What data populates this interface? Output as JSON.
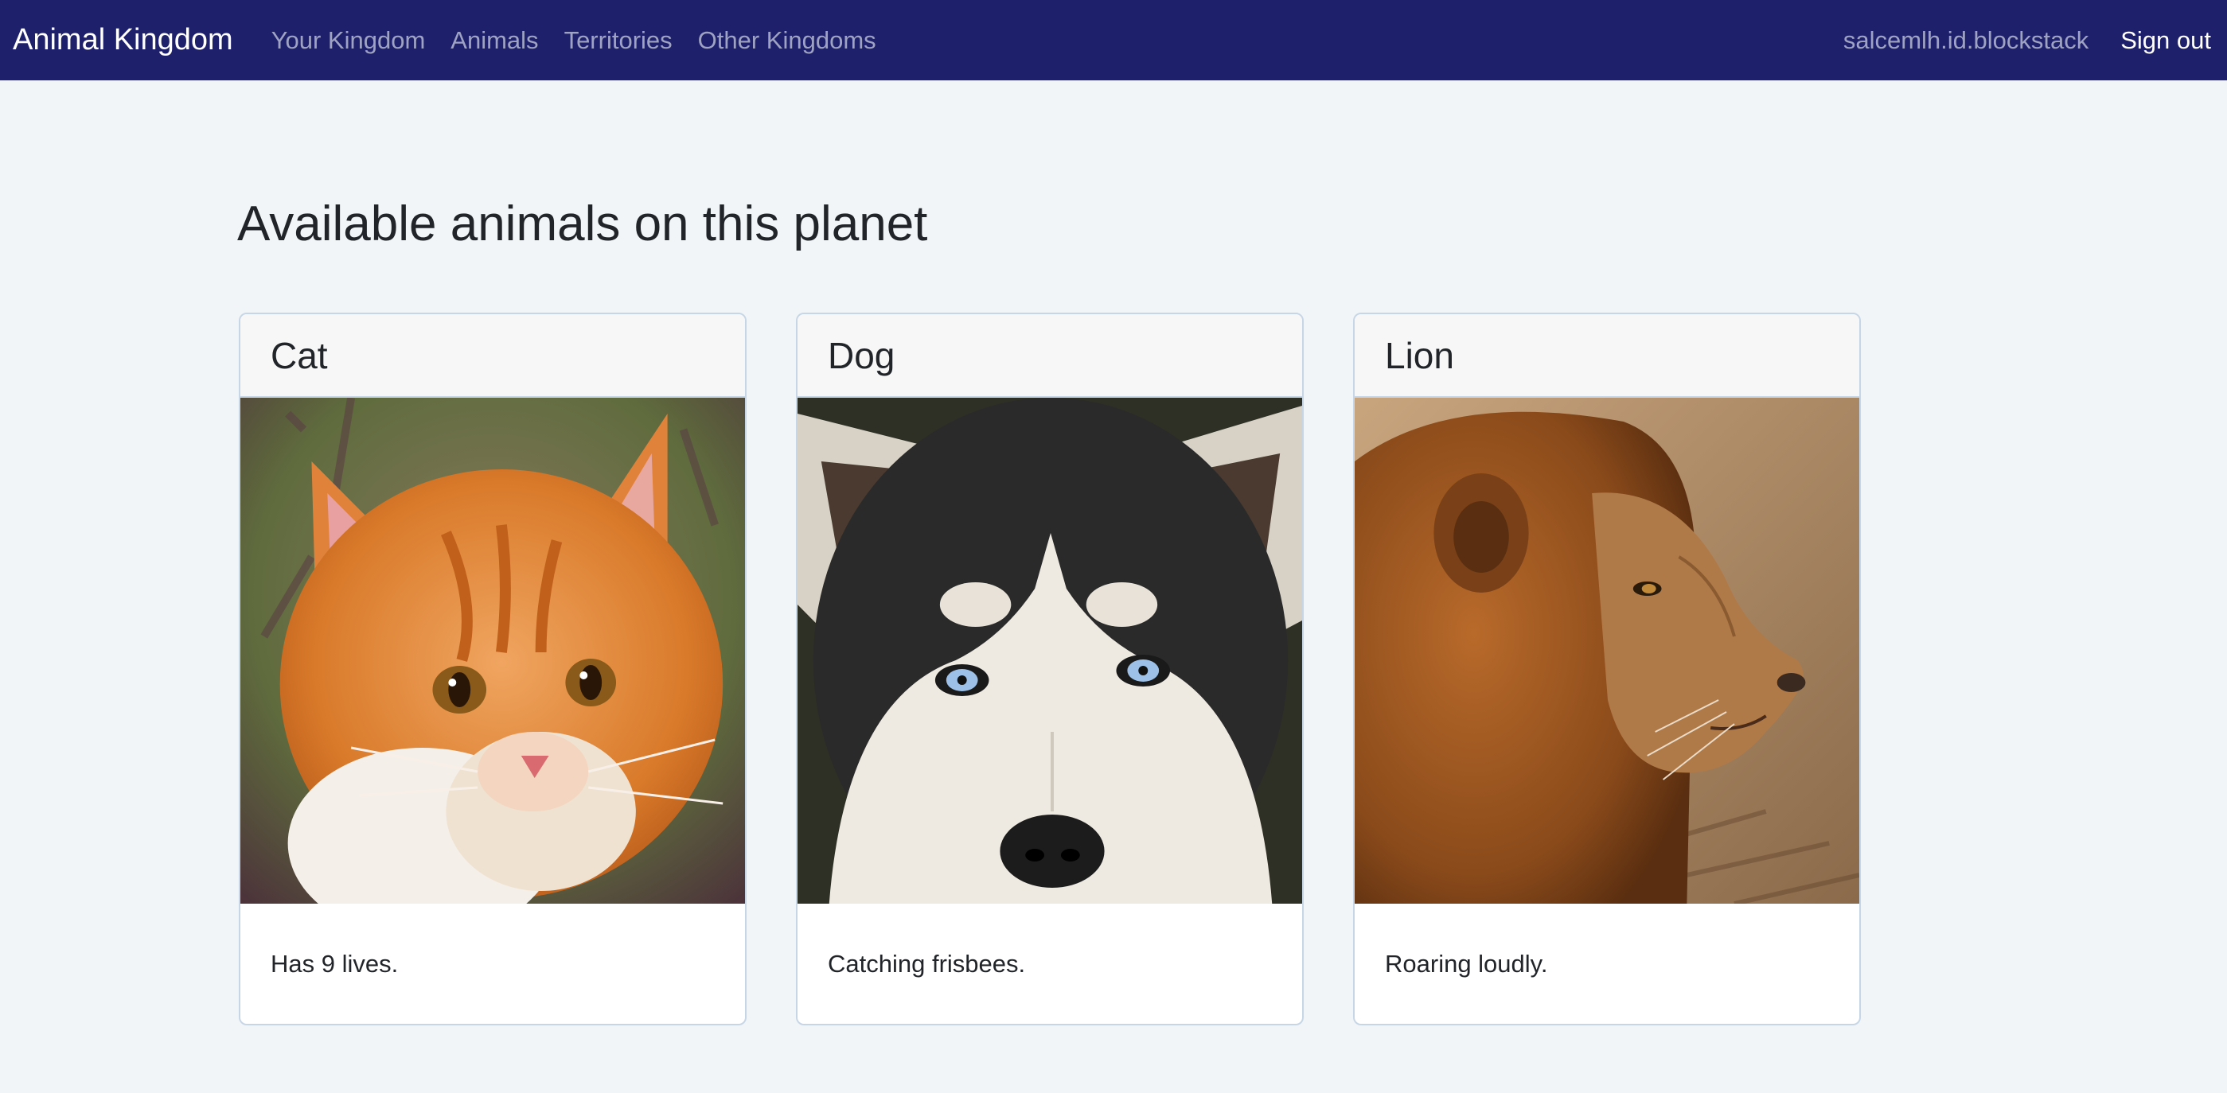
{
  "navbar": {
    "brand": "Animal Kingdom",
    "links": [
      "Your Kingdom",
      "Animals",
      "Territories",
      "Other Kingdoms"
    ],
    "user": "salcemlh.id.blockstack",
    "signout": "Sign out",
    "background": "#1e206b"
  },
  "main": {
    "title": "Available animals on this planet",
    "cards": [
      {
        "name": "Cat",
        "description": "Has 9 lives.",
        "image": "orange-kitten-photo"
      },
      {
        "name": "Dog",
        "description": "Catching frisbees.",
        "image": "husky-face-photo"
      },
      {
        "name": "Lion",
        "description": "Roaring loudly.",
        "image": "lion-profile-photo"
      }
    ]
  }
}
